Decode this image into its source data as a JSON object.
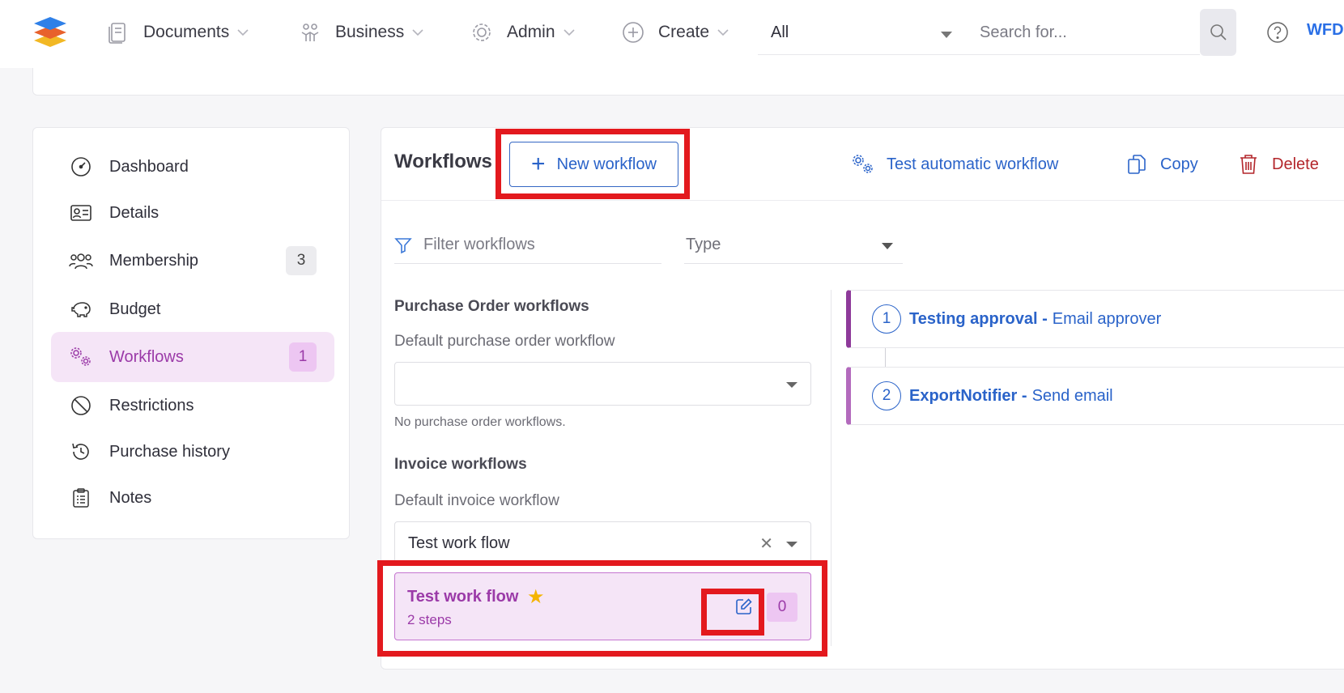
{
  "nav": {
    "documents": "Documents",
    "business": "Business",
    "admin": "Admin",
    "create": "Create",
    "scope_value": "All",
    "search_placeholder": "Search for...",
    "user_label": "WFD"
  },
  "sidebar": {
    "items": [
      {
        "label": "Dashboard",
        "icon": "dashboard-icon"
      },
      {
        "label": "Details",
        "icon": "id-card-icon"
      },
      {
        "label": "Membership",
        "icon": "users-icon",
        "badge": "3"
      },
      {
        "label": "Budget",
        "icon": "piggy-bank-icon"
      },
      {
        "label": "Workflows",
        "icon": "gears-icon",
        "badge": "1",
        "active": true
      },
      {
        "label": "Restrictions",
        "icon": "ban-icon"
      },
      {
        "label": "Purchase history",
        "icon": "history-icon"
      },
      {
        "label": "Notes",
        "icon": "clipboard-icon"
      }
    ]
  },
  "main": {
    "title": "Workflows",
    "new_workflow_label": "New workflow",
    "test_auto_label": "Test automatic workflow",
    "copy_label": "Copy",
    "delete_label": "Delete",
    "filter_placeholder": "Filter workflows",
    "type_placeholder": "Type",
    "po_section_title": "Purchase Order workflows",
    "po_default_label": "Default purchase order workflow",
    "po_empty_text": "No purchase order workflows.",
    "inv_section_title": "Invoice workflows",
    "inv_default_label": "Default invoice workflow",
    "inv_default_value": "Test work flow",
    "workflow_card": {
      "name": "Test work flow",
      "steps": "2 steps",
      "count": "0"
    },
    "steps": [
      {
        "num": "1",
        "name": "Testing approval -",
        "desc": "Email approver"
      },
      {
        "num": "2",
        "name": "ExportNotifier -",
        "desc": "Send email"
      }
    ]
  },
  "colors": {
    "accent_blue": "#2a63c9",
    "accent_purple": "#9b3aa8",
    "highlight_red": "#e3191e",
    "delete_red": "#b3262b"
  }
}
